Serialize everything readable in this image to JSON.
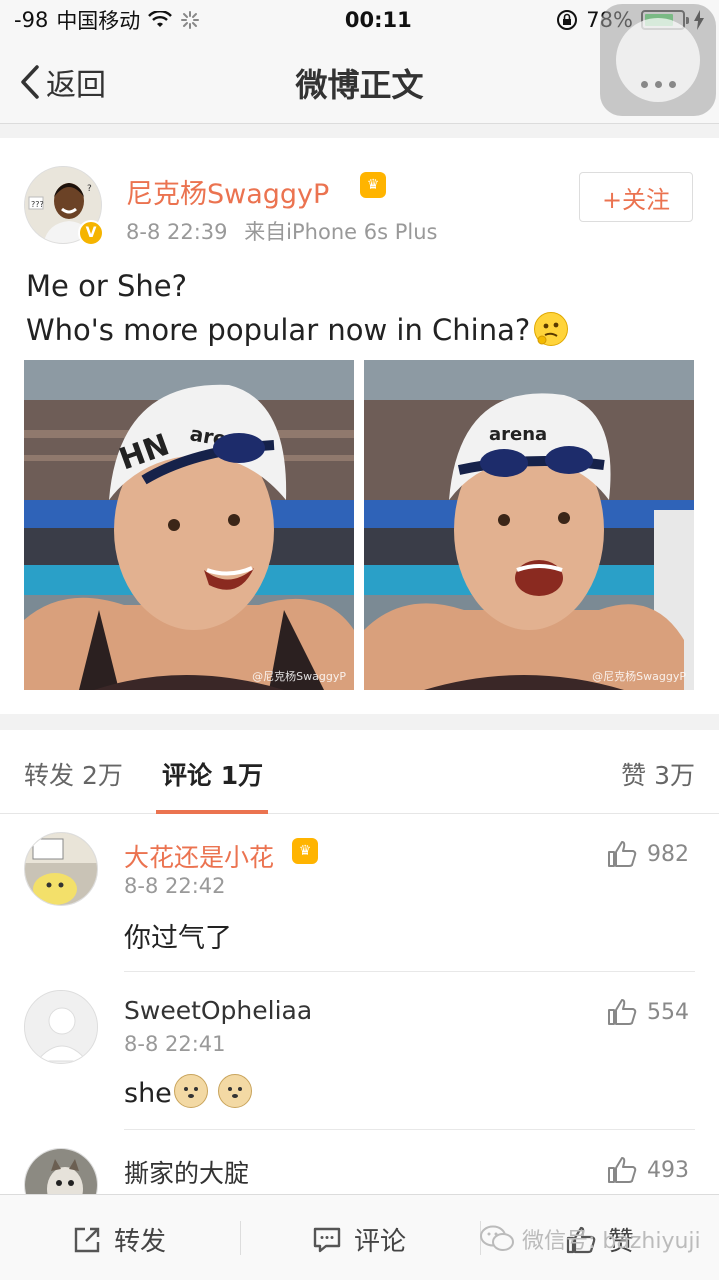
{
  "status_bar": {
    "signal": "-98",
    "carrier": "中国移动",
    "time": "00:11",
    "battery": "78%",
    "battery_level": 0.78
  },
  "nav": {
    "back_label": "返回",
    "title": "微博正文"
  },
  "post": {
    "author": "尼克杨SwaggyP",
    "time": "8-8 22:39",
    "source": "来自iPhone 6s Plus",
    "follow_label": "+关注",
    "text_line1": "Me or She?",
    "text_line2": "Who's more popular now in China?",
    "photo_watermark_1": "@尼克杨SwaggyP",
    "photo_watermark_2": "@尼克杨SwaggyP"
  },
  "tabs": {
    "repost": "转发 2万",
    "comment": "评论 1万",
    "like": "赞 3万"
  },
  "comments": [
    {
      "name": "大花还是小花",
      "time": "8-8 22:42",
      "text": "你过气了",
      "likes": "982"
    },
    {
      "name": "SweetOpheliaa",
      "time": "8-8 22:41",
      "text": "she",
      "likes": "554"
    },
    {
      "name": "撕家的大腚",
      "time": "",
      "text": "",
      "likes": "493"
    }
  ],
  "bottom_bar": {
    "repost": "转发",
    "comment": "评论",
    "like": "赞",
    "wechat_watermark": "微信号: bazhiyuji"
  },
  "colors": {
    "accent": "#eb7350",
    "vip": "#ffb400",
    "battery": "#4cd964"
  }
}
